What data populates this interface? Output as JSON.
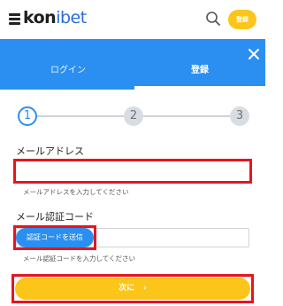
{
  "header": {
    "logo_text_part1": "kon",
    "logo_text_part2": "ibet",
    "signup_button": "登録",
    "icons": [
      "menu-icon",
      "search-icon"
    ]
  },
  "tabs": {
    "login_label": "ログイン",
    "register_label": "登録",
    "active": "register"
  },
  "stepper": {
    "steps": [
      "1",
      "2",
      "3"
    ],
    "current": 1
  },
  "form": {
    "email_label": "メールアドレス",
    "email_value": "",
    "email_hint": "メールアドレスを入力してください",
    "code_label": "メール認証コード",
    "send_code_button": "認証コードを送信",
    "code_value": "",
    "code_hint": "メール認証コードを入力してください",
    "next_button": "次に",
    "next_chevron": "›"
  },
  "colors": {
    "accent_blue": "#2b8ff1",
    "button_yellow": "#fcc51a",
    "highlight_red": "#e8141e"
  }
}
